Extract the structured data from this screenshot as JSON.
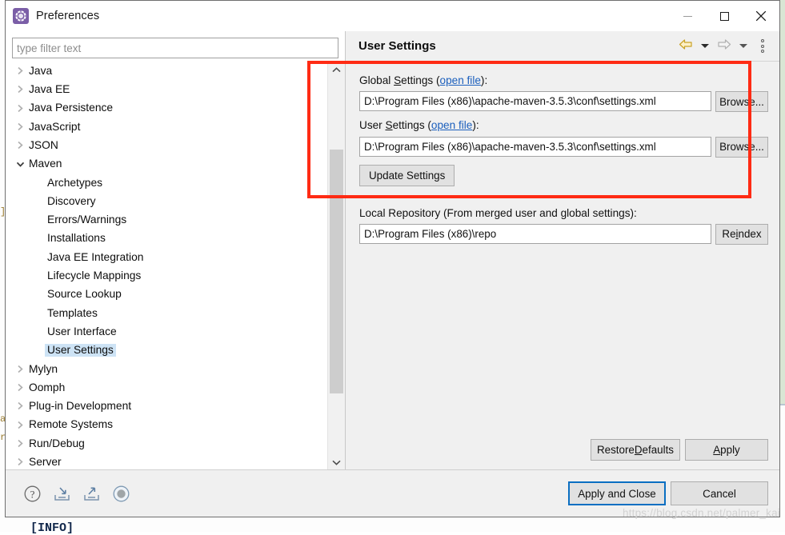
{
  "window": {
    "title": "Preferences",
    "icon": "preferences-gear-icon",
    "accent": "#0a6fc2",
    "annotation_color": "#ff2b14",
    "controls": {
      "minimize": "minimize-icon",
      "maximize": "maximize-icon",
      "close": "close-icon"
    }
  },
  "filter": {
    "placeholder": "type filter text",
    "value": ""
  },
  "tree": {
    "items": [
      {
        "label": "Java",
        "indent": 0,
        "state": "collapsed",
        "selected": false
      },
      {
        "label": "Java EE",
        "indent": 0,
        "state": "collapsed",
        "selected": false
      },
      {
        "label": "Java Persistence",
        "indent": 0,
        "state": "collapsed",
        "selected": false
      },
      {
        "label": "JavaScript",
        "indent": 0,
        "state": "collapsed",
        "selected": false
      },
      {
        "label": "JSON",
        "indent": 0,
        "state": "collapsed",
        "selected": false
      },
      {
        "label": "Maven",
        "indent": 0,
        "state": "expanded",
        "selected": false
      },
      {
        "label": "Archetypes",
        "indent": 1,
        "state": "leaf",
        "selected": false
      },
      {
        "label": "Discovery",
        "indent": 1,
        "state": "leaf",
        "selected": false
      },
      {
        "label": "Errors/Warnings",
        "indent": 1,
        "state": "leaf",
        "selected": false
      },
      {
        "label": "Installations",
        "indent": 1,
        "state": "leaf",
        "selected": false
      },
      {
        "label": "Java EE Integration",
        "indent": 1,
        "state": "leaf",
        "selected": false
      },
      {
        "label": "Lifecycle Mappings",
        "indent": 1,
        "state": "leaf",
        "selected": false
      },
      {
        "label": "Source Lookup",
        "indent": 1,
        "state": "leaf",
        "selected": false
      },
      {
        "label": "Templates",
        "indent": 1,
        "state": "leaf",
        "selected": false
      },
      {
        "label": "User Interface",
        "indent": 1,
        "state": "leaf",
        "selected": false
      },
      {
        "label": "User Settings",
        "indent": 1,
        "state": "leaf",
        "selected": true
      },
      {
        "label": "Mylyn",
        "indent": 0,
        "state": "collapsed",
        "selected": false
      },
      {
        "label": "Oomph",
        "indent": 0,
        "state": "collapsed",
        "selected": false
      },
      {
        "label": "Plug-in Development",
        "indent": 0,
        "state": "collapsed",
        "selected": false
      },
      {
        "label": "Remote Systems",
        "indent": 0,
        "state": "collapsed",
        "selected": false
      },
      {
        "label": "Run/Debug",
        "indent": 0,
        "state": "collapsed",
        "selected": false
      },
      {
        "label": "Server",
        "indent": 0,
        "state": "collapsed",
        "selected": false
      }
    ],
    "scrollbar": {
      "up_icon": "chevron-up-icon",
      "down_icon": "chevron-down-icon"
    }
  },
  "page": {
    "title": "User Settings",
    "nav": {
      "back_icon": "arrow-left-icon",
      "back_menu_icon": "caret-down-icon",
      "forward_icon": "arrow-right-icon",
      "forward_menu_icon": "caret-down-icon",
      "menu_icon": "kebab-menu-icon"
    },
    "global_settings": {
      "label_before": "Global ",
      "label_mnemonic": "S",
      "label_after": "ettings (",
      "link": "open file",
      "label_end": "):",
      "value": "D:\\Program Files (x86)\\apache-maven-3.5.3\\conf\\settings.xml",
      "browse_label": "Browse..."
    },
    "user_settings": {
      "label_before": "User ",
      "label_mnemonic": "S",
      "label_after": "ettings (",
      "link": "open file",
      "label_end": "):",
      "value": "D:\\Program Files (x86)\\apache-maven-3.5.3\\conf\\settings.xml",
      "browse_label": "Browse..."
    },
    "update_settings_label": "Update Settings",
    "local_repository": {
      "label": "Local Repository (From merged user and global settings):",
      "value": "D:\\Program Files (x86)\\repo",
      "reindex_before": "Re",
      "reindex_mnemonic": "i",
      "reindex_after": "ndex"
    },
    "restore_defaults": {
      "before": "Restore ",
      "mnemonic": "D",
      "after": "efaults"
    },
    "apply": {
      "before": "",
      "mnemonic": "A",
      "after": "pply"
    }
  },
  "footer": {
    "icons": [
      {
        "name": "help-icon"
      },
      {
        "name": "import-icon"
      },
      {
        "name": "export-icon"
      },
      {
        "name": "record-icon"
      }
    ],
    "apply_and_close_label": "Apply and Close",
    "cancel_label": "Cancel"
  },
  "background": {
    "console_fragments": [
      "]",
      "a",
      "r]"
    ],
    "info_text": "[INFO]",
    "watermark": "https://blog.csdn.net/palmer_kai"
  }
}
